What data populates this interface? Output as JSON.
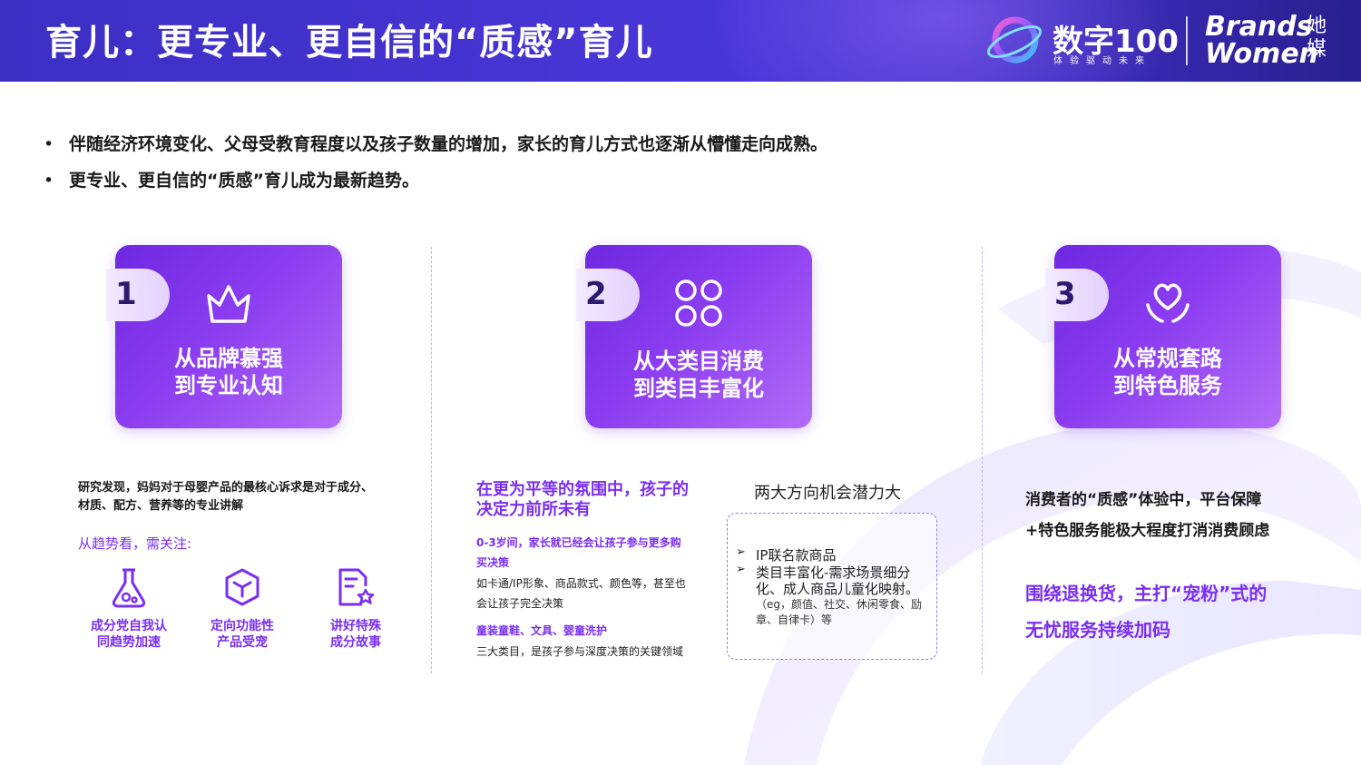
{
  "header": {
    "title": "育儿：更专业、更自信的“质感”育儿",
    "logo_main": "数字100",
    "logo_sub": "体验驱动未来",
    "logo_brand_line1": "Brands",
    "logo_brand_line2": "Women",
    "logo_brand_cn": "她媒"
  },
  "bullets": [
    "伴随经济环境变化、父母受教育程度以及孩子数量的增加，家长的育儿方式也逐渐从懵懂走向成熟。",
    "更专业、更自信的“质感”育儿成为最新趋势。"
  ],
  "bullet_marker": "•",
  "cards": [
    {
      "number": "1",
      "icon": "crown-icon",
      "line1": "从品牌慕强",
      "line2": "到专业认知"
    },
    {
      "number": "2",
      "icon": "grid-icon",
      "line1": "从大类目消费",
      "line2": "到类目丰富化"
    },
    {
      "number": "3",
      "icon": "heart-hands-icon",
      "line1": "从常规套路",
      "line2": "到特色服务"
    }
  ],
  "col1": {
    "intro_line1": "研究发现，妈妈对于母婴产品的最核心诉求是对于成分、",
    "intro_line2": "材质、配方、营养等的专业讲解",
    "trend_label": "从趋势看，需关注:",
    "features": [
      {
        "icon": "flask-icon",
        "line1": "成分党自我认",
        "line2": "同趋势加速"
      },
      {
        "icon": "cube-icon",
        "line1": "定向功能性",
        "line2": "产品受宠"
      },
      {
        "icon": "document-star-icon",
        "line1": "讲好特殊",
        "line2": "成分故事"
      }
    ]
  },
  "col2": {
    "headline_line1": "在更为平等的氛围中，孩子的",
    "headline_line2": "决定力前所未有",
    "sub1_line1": "0-3岁间，家长就已经会让孩子参与更多购",
    "sub1_line2": "买决策",
    "desc1_line1": "如卡通/IP形象、商品款式、颜色等，甚至也",
    "desc1_line2": "会让孩子完全决策",
    "sub2": "童装童鞋、文具、婴童洗护",
    "desc2": "三大类目，是孩子参与深度决策的关键领域",
    "right_title": "两大方向机会潜力大",
    "box_marker": "➢",
    "box_item1": "IP联名款商品",
    "box_item2_line1": "类目丰富化-需求场景细分",
    "box_item2_line2": "化、成人商品儿童化映射。",
    "box_note_line1": "（eg，颜值、社交、休闲零食、励",
    "box_note_line2": "章、自律卡）等"
  },
  "col3": {
    "text_line1": "消费者的“质感”体验中，平台保障",
    "text_line2": "+特色服务能极大程度打消消费顾虑",
    "highlight_line1": "围绕退换货，主打“宠粉”式的",
    "highlight_line2": "无忧服务持续加码"
  },
  "colors": {
    "header_bg": "#3c2fc4",
    "card_gradient_start": "#6d28e0",
    "card_gradient_end": "#b26cf7",
    "accent_purple": "#7a2ff0"
  }
}
